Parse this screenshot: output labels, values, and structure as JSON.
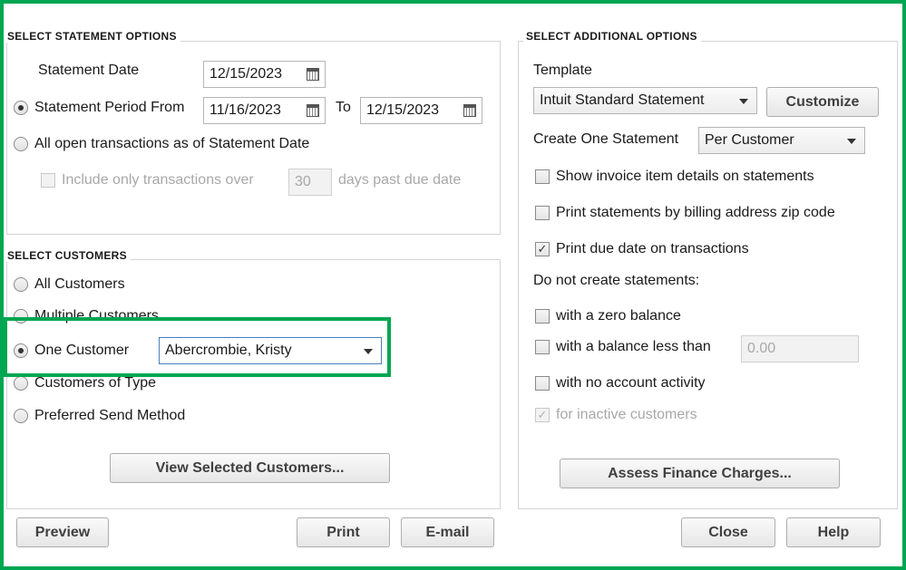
{
  "statement_options": {
    "title": "SELECT STATEMENT OPTIONS",
    "statement_date_label": "Statement Date",
    "statement_date": "12/15/2023",
    "period_from_label": "Statement Period From",
    "period_from": "11/16/2023",
    "to_label": "To",
    "period_to": "12/15/2023",
    "open_transactions_label": "All open transactions as of Statement Date",
    "include_only_label": "Include only transactions over",
    "days_value": "30",
    "days_past_label": "days past due date",
    "selected_mode": "period"
  },
  "select_customers": {
    "title": "SELECT CUSTOMERS",
    "all_customers": "All Customers",
    "multiple_customers": "Multiple Customers",
    "one_customer": "One Customer",
    "customer_value": "Abercrombie, Kristy",
    "customers_of_type": "Customers of Type",
    "preferred_send": "Preferred Send Method",
    "view_selected_button": "View Selected Customers...",
    "selected": "one_customer"
  },
  "additional_options": {
    "title": "SELECT ADDITIONAL OPTIONS",
    "template_label": "Template",
    "template_value": "Intuit Standard Statement",
    "customize_button": "Customize",
    "create_one_label": "Create One Statement",
    "create_one_value": "Per Customer",
    "show_invoice_details": "Show invoice item details on statements",
    "print_by_zip": "Print statements by billing address zip code",
    "print_due_date": "Print due date on transactions",
    "do_not_create_label": "Do not create statements:",
    "zero_balance": "with a zero balance",
    "balance_less_than": "with a balance less than",
    "balance_value": "0.00",
    "no_activity": "with no account activity",
    "inactive_customers": "for inactive customers",
    "assess_finance_button": "Assess Finance Charges..."
  },
  "buttons": {
    "preview": "Preview",
    "print": "Print",
    "email": "E-mail",
    "close": "Close",
    "help": "Help"
  },
  "colors": {
    "highlight": "#00a651",
    "focus_border": "#4a7fc0"
  }
}
